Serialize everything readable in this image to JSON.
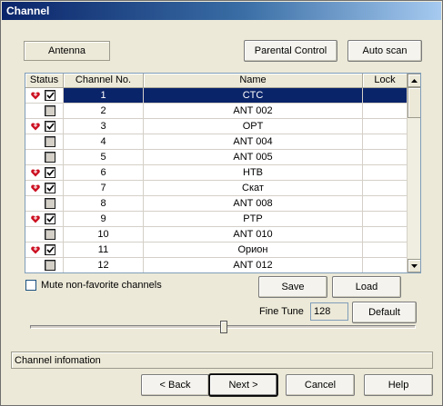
{
  "window": {
    "title": "Channel"
  },
  "toolbar": {
    "antenna_label": "Antenna",
    "parental_control_label": "Parental Control",
    "auto_scan_label": "Auto scan"
  },
  "table": {
    "columns": [
      "Status",
      "Channel No.",
      "Name",
      "Lock"
    ],
    "rows": [
      {
        "favorite": true,
        "checked": true,
        "number": "1",
        "name": "CTC",
        "lock": "",
        "selected": true
      },
      {
        "favorite": false,
        "checked": false,
        "number": "2",
        "name": "ANT 002",
        "lock": ""
      },
      {
        "favorite": true,
        "checked": true,
        "number": "3",
        "name": "OPT",
        "lock": ""
      },
      {
        "favorite": false,
        "checked": false,
        "number": "4",
        "name": "ANT 004",
        "lock": ""
      },
      {
        "favorite": false,
        "checked": false,
        "number": "5",
        "name": "ANT 005",
        "lock": ""
      },
      {
        "favorite": true,
        "checked": true,
        "number": "6",
        "name": "HTB",
        "lock": ""
      },
      {
        "favorite": true,
        "checked": true,
        "number": "7",
        "name": "Скат",
        "lock": ""
      },
      {
        "favorite": false,
        "checked": false,
        "number": "8",
        "name": "ANT 008",
        "lock": ""
      },
      {
        "favorite": true,
        "checked": true,
        "number": "9",
        "name": "PTP",
        "lock": ""
      },
      {
        "favorite": false,
        "checked": false,
        "number": "10",
        "name": "ANT 010",
        "lock": ""
      },
      {
        "favorite": true,
        "checked": true,
        "number": "11",
        "name": "Орион",
        "lock": ""
      },
      {
        "favorite": false,
        "checked": false,
        "number": "12",
        "name": "ANT 012",
        "lock": ""
      }
    ]
  },
  "options": {
    "mute_label": "Mute non-favorite channels",
    "mute_checked": false,
    "save_label": "Save",
    "load_label": "Load"
  },
  "fine_tune": {
    "label": "Fine Tune",
    "value": "128",
    "default_label": "Default"
  },
  "status": {
    "info_text": "Channel infomation"
  },
  "footer": {
    "back_label": "< Back",
    "next_label": "Next >",
    "cancel_label": "Cancel",
    "help_label": "Help"
  },
  "colors": {
    "heart": "#cc1122",
    "selection": "#0a246a"
  }
}
